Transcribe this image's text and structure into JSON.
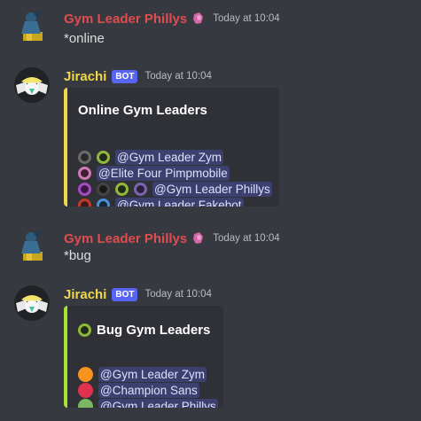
{
  "messages": [
    {
      "author": "Gym Leader Phillys",
      "timestamp": "Today at 10:04",
      "text": "*online"
    },
    {
      "author": "Jirachi",
      "bot_tag": "BOT",
      "timestamp": "Today at 10:04",
      "embed": {
        "title": "Online Gym Leaders",
        "accent": "#f1d84b",
        "rows": [
          {
            "icons": [
              "dark-badge-icon",
              "bug-badge-icon"
            ],
            "mention": "@Gym Leader Zym"
          },
          {
            "icons": [
              "psychic-badge-icon"
            ],
            "mention": "@Elite Four Pimpmobile"
          },
          {
            "icons": [
              "poison-badge-icon",
              "dark-badge-icon",
              "bug-badge-icon",
              "ghost-badge-icon"
            ],
            "mention": "@Gym Leader Phillys"
          },
          {
            "icons": [
              "fire-badge-icon",
              "water-badge-icon"
            ],
            "mention": "@Gym Leader Fakebot"
          }
        ]
      }
    },
    {
      "author": "Gym Leader Phillys",
      "timestamp": "Today at 10:04",
      "text": "*bug"
    },
    {
      "author": "Jirachi",
      "bot_tag": "BOT",
      "timestamp": "Today at 10:04",
      "embed": {
        "title": "Bug Gym Leaders",
        "title_icon": "bug-badge-icon",
        "accent": "#a6e22e",
        "rows": [
          {
            "color": "#f7931e",
            "mention": "@Gym Leader Zym"
          },
          {
            "color": "#e0314f",
            "mention": "@Champion Sans"
          },
          {
            "color": "#7bb661",
            "mention": "@Gym Leader Phillys"
          }
        ]
      }
    }
  ],
  "colors": {
    "background": "#36393f",
    "embed_bg": "#2f3136",
    "user_name": "#e04d4f",
    "bot_name": "#f1d84b",
    "bot_tag": "#5865f2"
  }
}
